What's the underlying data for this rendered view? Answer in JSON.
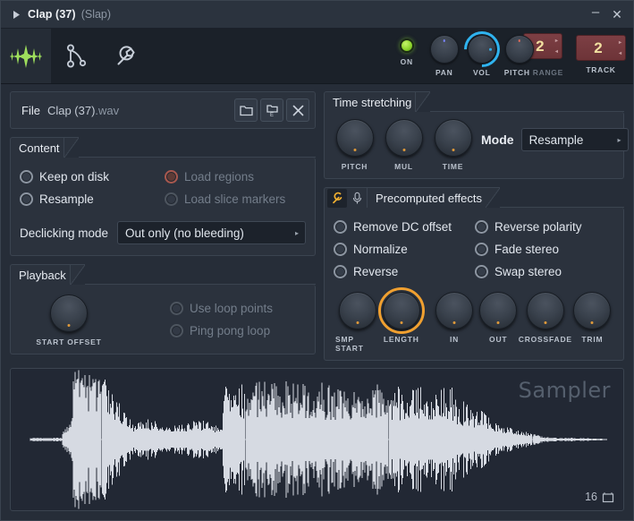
{
  "titlebar": {
    "expand_icon": "triangle-right-icon",
    "title": "Clap (37)",
    "subtitle": "(Slap)",
    "minimize_label": "–",
    "close_label": "✕"
  },
  "toolbar": {
    "icons": [
      {
        "name": "waveform-icon",
        "active": true
      },
      {
        "name": "envelope-icon",
        "active": false
      },
      {
        "name": "wrench-icon",
        "active": false
      }
    ],
    "controls": {
      "on_label": "ON",
      "pan_label": "PAN",
      "vol_label": "VOL",
      "pitch_label": "PITCH",
      "range_label": "RANGE",
      "pitch_range_value": "2",
      "track_label": "TRACK",
      "track_value": "2"
    },
    "colors": {
      "led_green": "#8fd62e",
      "vol_ring_blue": "#2fb3ef",
      "numbox_red": "#7d3f44",
      "numbox_text": "#f2e0a0"
    }
  },
  "file": {
    "label": "File",
    "name": "Clap (37)",
    "extension": ".wav",
    "buttons": [
      {
        "name": "open-file-button",
        "icon": "folder-icon"
      },
      {
        "name": "save-file-button",
        "icon": "folder-export-icon"
      },
      {
        "name": "clear-file-button",
        "icon": "close-icon"
      }
    ]
  },
  "content": {
    "title": "Content",
    "options_left": [
      {
        "label": "Keep on disk",
        "state": "off",
        "disabled": false
      },
      {
        "label": "Resample",
        "state": "off",
        "disabled": false
      }
    ],
    "options_right": [
      {
        "label": "Load regions",
        "state": "red",
        "disabled": true
      },
      {
        "label": "Load slice markers",
        "state": "off",
        "disabled": true
      }
    ],
    "declicking_label": "Declicking mode",
    "declicking_value": "Out only (no bleeding)"
  },
  "playback": {
    "title": "Playback",
    "start_offset_label": "START OFFSET",
    "options": [
      {
        "label": "Use loop points",
        "disabled": true
      },
      {
        "label": "Ping pong loop",
        "disabled": true
      }
    ]
  },
  "time_stretching": {
    "title": "Time stretching",
    "knobs": [
      {
        "label": "PITCH"
      },
      {
        "label": "MUL"
      },
      {
        "label": "TIME"
      }
    ],
    "mode_label": "Mode",
    "mode_value": "Resample"
  },
  "precomputed": {
    "title": "Precomputed effects",
    "tab_icons": [
      {
        "name": "wrench-icon",
        "active": true
      },
      {
        "name": "microphone-icon",
        "active": false
      }
    ],
    "options_left": [
      {
        "label": "Remove DC offset"
      },
      {
        "label": "Normalize"
      },
      {
        "label": "Reverse"
      }
    ],
    "options_right": [
      {
        "label": "Reverse polarity"
      },
      {
        "label": "Fade stereo"
      },
      {
        "label": "Swap stereo"
      }
    ],
    "knobs": [
      {
        "label": "SMP START",
        "highlight": false
      },
      {
        "label": "LENGTH",
        "highlight": true
      },
      {
        "label": "IN",
        "highlight": false
      },
      {
        "label": "OUT",
        "highlight": false
      },
      {
        "label": "CROSSFADE",
        "highlight": false
      },
      {
        "label": "TRIM",
        "highlight": false
      }
    ],
    "highlight_color": "#f0a030"
  },
  "waveform": {
    "watermark": "Sampler",
    "bitdepth": "16",
    "bitdepth_icon": "bitdepth-icon"
  }
}
